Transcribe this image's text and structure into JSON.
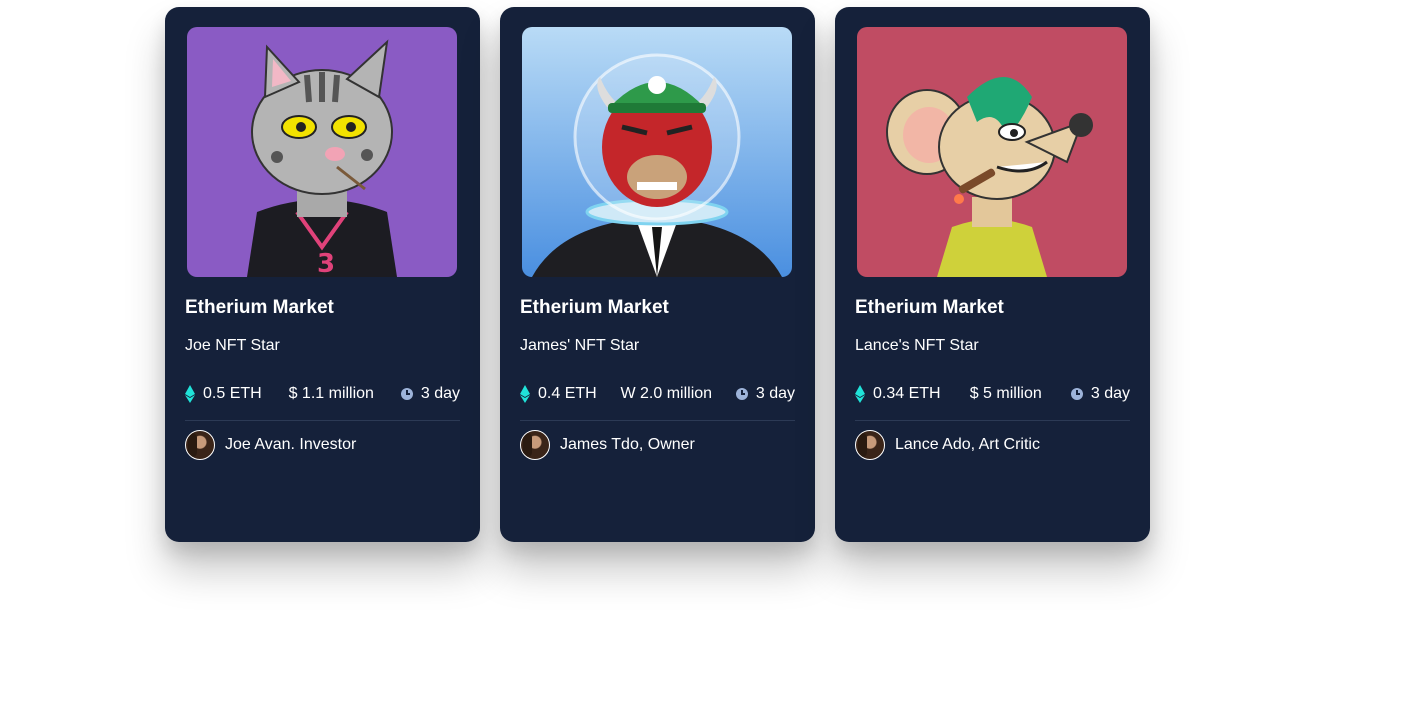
{
  "cards": [
    {
      "title": "Etherium Market",
      "subtitle": "Joe NFT Star",
      "eth": "0.5 ETH",
      "price": "$ 1.1 million",
      "time": "3 day",
      "owner": "Joe Avan. Investor",
      "art_bg": "#8a5bc4"
    },
    {
      "title": "Etherium Market",
      "subtitle": "James' NFT Star",
      "eth": "0.4 ETH",
      "price": "W 2.0 million",
      "time": "3 day",
      "owner": "James Tdo, Owner",
      "art_bg": "#6fa8e6"
    },
    {
      "title": "Etherium Market",
      "subtitle": "Lance's NFT Star",
      "eth": "0.34 ETH",
      "price": "$ 5 million",
      "time": "3 day",
      "owner": "Lance Ado, Art Critic",
      "art_bg": "#c04c63"
    }
  ],
  "icons": {
    "eth": "ethereum-icon",
    "clock": "clock-icon",
    "avatar": "avatar"
  },
  "colors": {
    "card_bg": "#15213a",
    "eth_accent": "#20e3d9",
    "clock": "#9db3d9"
  }
}
